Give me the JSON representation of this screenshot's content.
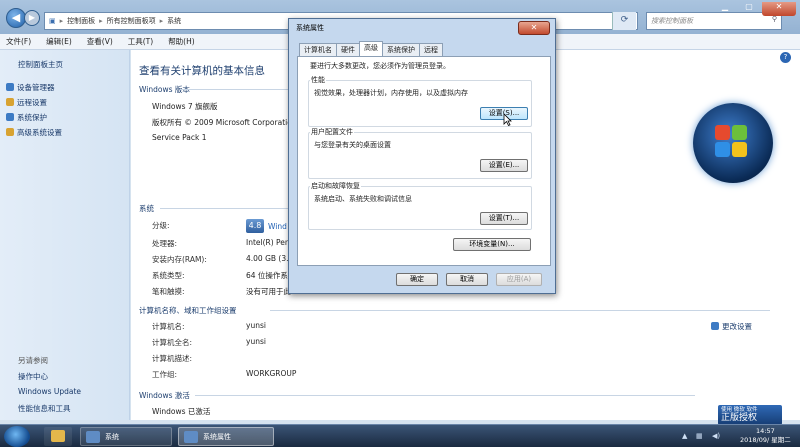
{
  "explorer": {
    "breadcrumb": [
      "控制面板",
      "所有控制面板项",
      "系统"
    ],
    "search_placeholder": "搜索控制面板",
    "menu": [
      "文件(F)",
      "编辑(E)",
      "查看(V)",
      "工具(T)",
      "帮助(H)"
    ],
    "sidebar": {
      "home": "控制面板主页",
      "links": [
        "设备管理器",
        "远程设置",
        "系统保护",
        "高级系统设置"
      ],
      "see_also_title": "另请参阅",
      "see_also": [
        "操作中心",
        "Windows Update",
        "性能信息和工具"
      ]
    },
    "page_title": "查看有关计算机的基本信息",
    "edition": {
      "section": "Windows 版本",
      "name": "Windows 7 旗舰版",
      "copyright": "版权所有 © 2009 Microsoft Corporatio",
      "sp": "Service Pack 1"
    },
    "system": {
      "section": "系统",
      "rating_label": "分级:",
      "rating_score": "4.8",
      "rating_text": "Wind",
      "rows": [
        {
          "label": "处理器:",
          "value": "Intel(R) Pent"
        },
        {
          "label": "安装内存(RAM):",
          "value": "4.00 GB (3.9"
        },
        {
          "label": "系统类型:",
          "value": "64 位操作系"
        },
        {
          "label": "笔和触摸:",
          "value": "没有可用于此"
        }
      ]
    },
    "computer": {
      "section": "计算机名称、域和工作组设置",
      "change_link": "更改设置",
      "rows": [
        {
          "label": "计算机名:",
          "value": "yunsi"
        },
        {
          "label": "计算机全名:",
          "value": "yunsi"
        },
        {
          "label": "计算机描述:",
          "value": ""
        },
        {
          "label": "工作组:",
          "value": "WORKGROUP"
        }
      ]
    },
    "activation": {
      "section": "Windows 激活",
      "status": "Windows 已激活"
    },
    "genuine": {
      "line1": "使用 微软 软件",
      "line2": "正版授权"
    }
  },
  "dialog": {
    "title": "系统属性",
    "close": "✕",
    "tabs": [
      "计算机名",
      "硬件",
      "高级",
      "系统保护",
      "远程"
    ],
    "active_tab": "高级",
    "note": "要进行大多数更改，您必须作为管理员登录。",
    "groups": [
      {
        "title": "性能",
        "desc": "视觉效果，处理器计划，内存使用，以及虚拟内存",
        "button": "设置(S)..."
      },
      {
        "title": "用户配置文件",
        "desc": "与您登录有关的桌面设置",
        "button": "设置(E)..."
      },
      {
        "title": "启动和故障恢复",
        "desc": "系统启动、系统失败和调试信息",
        "button": "设置(T)..."
      }
    ],
    "env_button": "环境变量(N)...",
    "ok": "确定",
    "cancel": "取消",
    "apply": "应用(A)"
  },
  "taskbar": {
    "items": [
      "系统",
      "系统属性"
    ],
    "time": "14:57",
    "date": "2018/09/ 星期二"
  }
}
